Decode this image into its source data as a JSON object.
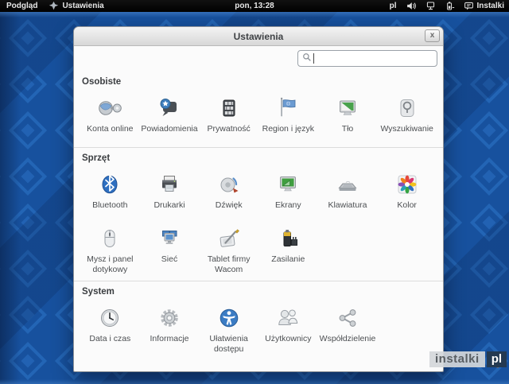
{
  "top_bar": {
    "activities_label": "Podgląd",
    "app_menu_label": "Ustawienia",
    "clock": "pon, 13:28",
    "keyboard_layout": "pl",
    "user_name": "Instalki"
  },
  "window": {
    "title": "Ustawienia",
    "close_label": "x",
    "search_placeholder": "",
    "search_value": "",
    "sections": [
      {
        "title": "Osobiste",
        "items": [
          {
            "label": "Konta online",
            "icon": "online-accounts"
          },
          {
            "label": "Powiadomienia",
            "icon": "notifications"
          },
          {
            "label": "Prywatność",
            "icon": "privacy"
          },
          {
            "label": "Region i język",
            "icon": "region"
          },
          {
            "label": "Tło",
            "icon": "background"
          },
          {
            "label": "Wyszukiwanie",
            "icon": "search"
          }
        ]
      },
      {
        "title": "Sprzęt",
        "items": [
          {
            "label": "Bluetooth",
            "icon": "bluetooth"
          },
          {
            "label": "Drukarki",
            "icon": "printers"
          },
          {
            "label": "Dźwięk",
            "icon": "sound"
          },
          {
            "label": "Ekrany",
            "icon": "displays"
          },
          {
            "label": "Klawiatura",
            "icon": "keyboard"
          },
          {
            "label": "Kolor",
            "icon": "color"
          },
          {
            "label": "Mysz i panel dotykowy",
            "icon": "mouse"
          },
          {
            "label": "Sieć",
            "icon": "network"
          },
          {
            "label": "Tablet firmy Wacom",
            "icon": "wacom"
          },
          {
            "label": "Zasilanie",
            "icon": "power"
          }
        ]
      },
      {
        "title": "System",
        "items": [
          {
            "label": "Data i czas",
            "icon": "datetime"
          },
          {
            "label": "Informacje",
            "icon": "details"
          },
          {
            "label": "Ułatwienia dostępu",
            "icon": "a11y"
          },
          {
            "label": "Użytkownicy",
            "icon": "users"
          },
          {
            "label": "Współdzielenie",
            "icon": "sharing"
          }
        ]
      }
    ]
  },
  "watermark": {
    "text": "instalki",
    "suffix": "pl"
  },
  "colors": {
    "desktop_blue": "#17519e",
    "pattern_blue": "#2e74c8",
    "accent_blue": "#3b7cc4",
    "watermark_orange": "#e07a1f",
    "topbar_black": "#000000"
  }
}
